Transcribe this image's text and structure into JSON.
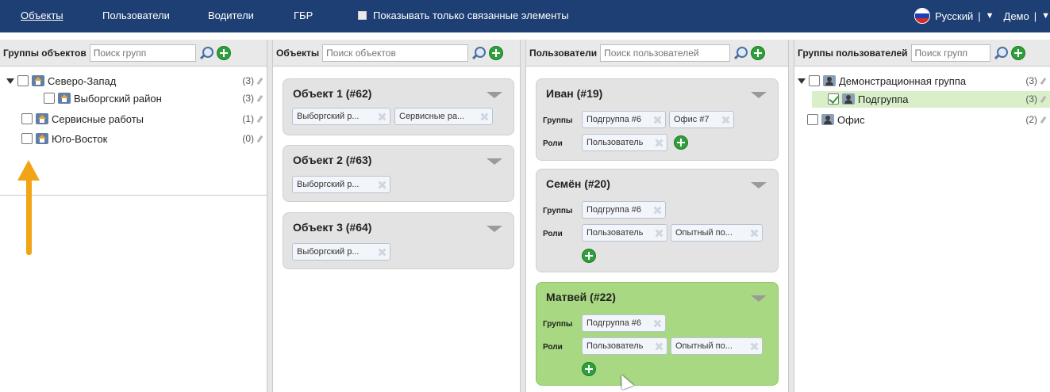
{
  "topbar": {
    "nav": [
      "Объекты",
      "Пользователи",
      "Водители",
      "ГБР"
    ],
    "show_linked_label": "Показывать только связанные элементы",
    "language": "Русский",
    "account": "Демо",
    "separator": "|",
    "dropdown_glyph": "▼"
  },
  "columns": {
    "object_groups": {
      "title": "Группы объектов",
      "search_placeholder": "Поиск групп",
      "tree": [
        {
          "label": "Северо-Запад",
          "count": "(3)"
        },
        {
          "label": "Выборгский район",
          "count": "(3)"
        },
        {
          "label": "Сервисные работы",
          "count": "(1)"
        },
        {
          "label": "Юго-Восток",
          "count": "(0)"
        }
      ]
    },
    "objects": {
      "title": "Объекты",
      "search_placeholder": "Поиск объектов",
      "cards": [
        {
          "title": "Объект 1 (#62)",
          "tags": [
            "Выборгский р...",
            "Сервисные ра..."
          ]
        },
        {
          "title": "Объект 2 (#63)",
          "tags": [
            "Выборгский р..."
          ]
        },
        {
          "title": "Объект 3 (#64)",
          "tags": [
            "Выборгский р..."
          ]
        }
      ]
    },
    "users": {
      "title": "Пользователи",
      "search_placeholder": "Поиск пользователей",
      "groups_label": "Группы",
      "roles_label": "Роли",
      "cards": [
        {
          "title": "Иван (#19)",
          "groups": [
            "Подгруппа #6",
            "Офис #7"
          ],
          "roles": [
            "Пользователь"
          ]
        },
        {
          "title": "Семён (#20)",
          "groups": [
            "Подгруппа #6"
          ],
          "roles": [
            "Пользователь",
            "Опытный по..."
          ]
        },
        {
          "title": "Матвей (#22)",
          "groups": [
            "Подгруппа #6"
          ],
          "roles": [
            "Пользователь",
            "Опытный по..."
          ]
        }
      ]
    },
    "user_groups": {
      "title": "Группы пользователей",
      "search_placeholder": "Поиск групп",
      "tree": [
        {
          "label": "Демонстрационная группа",
          "count": "(3)"
        },
        {
          "label": "Подгруппа",
          "count": "(3)",
          "checked": true
        },
        {
          "label": "Офис",
          "count": "(2)"
        }
      ]
    }
  },
  "colors": {
    "topbar": "#1e3f73",
    "highlight_card": "#a8d882",
    "annotation_arrow": "#f1a416"
  }
}
